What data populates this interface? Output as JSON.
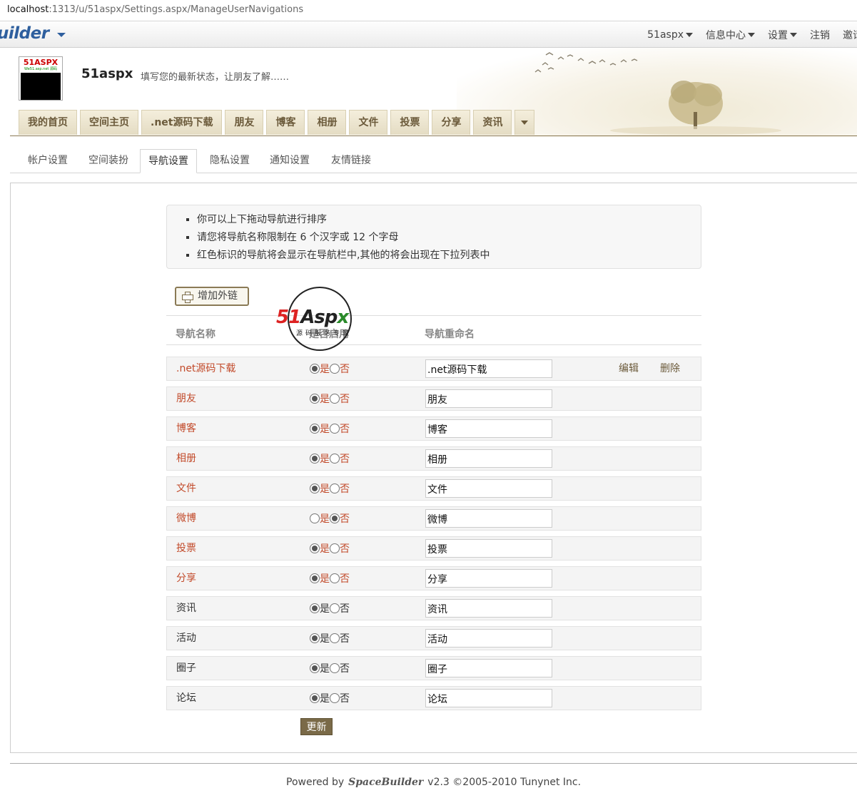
{
  "browser": {
    "url_host": "localhost",
    "url_path": ":1313/u/51aspx/Settings.aspx/ManageUserNavigations"
  },
  "topbar": {
    "brand": "uilder",
    "menu": [
      {
        "label": "51aspx",
        "dropdown": true
      },
      {
        "label": "信息中心",
        "dropdown": true
      },
      {
        "label": "设置",
        "dropdown": true
      },
      {
        "label": "注销",
        "dropdown": false
      },
      {
        "label": "邀请",
        "dropdown": false
      }
    ]
  },
  "header": {
    "avatar_logo": "51ASPX",
    "avatar_logo_sub": "We51.asp.net 源码",
    "username": "51aspx",
    "status_placeholder": "填写您的最新状态，让朋友了解……",
    "nav_tabs": [
      "我的首页",
      "空间主页",
      ".net源码下载",
      "朋友",
      "博客",
      "相册",
      "文件",
      "投票",
      "分享",
      "资讯"
    ]
  },
  "sub_tabs": [
    "帐户设置",
    "空间装扮",
    "导航设置",
    "隐私设置",
    "通知设置",
    "友情链接"
  ],
  "active_sub_tab": "导航设置",
  "tips": [
    "你可以上下拖动导航进行排序",
    "请您将导航名称限制在 6 个汉字或 12 个字母",
    "红色标识的导航将会显示在导航栏中,其他的将会出现在下拉列表中"
  ],
  "add_button": "增加外链",
  "columns": {
    "name": "导航名称",
    "enabled": "是否启用",
    "rename": "导航重命名"
  },
  "watermark": {
    "red": "51",
    "black": "Asp",
    "green": "x",
    "sub": "源码服务专家"
  },
  "radio_labels": {
    "yes": "是",
    "no": "否"
  },
  "row_actions": {
    "edit": "编辑",
    "delete": "删除"
  },
  "rows": [
    {
      "name": ".net源码下载",
      "enabled": true,
      "rename": ".net源码下载",
      "highlight": true,
      "actions": true
    },
    {
      "name": "朋友",
      "enabled": true,
      "rename": "朋友",
      "highlight": true
    },
    {
      "name": "博客",
      "enabled": true,
      "rename": "博客",
      "highlight": true
    },
    {
      "name": "相册",
      "enabled": true,
      "rename": "相册",
      "highlight": true
    },
    {
      "name": "文件",
      "enabled": true,
      "rename": "文件",
      "highlight": true
    },
    {
      "name": "微博",
      "enabled": false,
      "rename": "微博",
      "highlight": true
    },
    {
      "name": "投票",
      "enabled": true,
      "rename": "投票",
      "highlight": true
    },
    {
      "name": "分享",
      "enabled": true,
      "rename": "分享",
      "highlight": true
    },
    {
      "name": "资讯",
      "enabled": true,
      "rename": "资讯",
      "highlight": false
    },
    {
      "name": "活动",
      "enabled": true,
      "rename": "活动",
      "highlight": false
    },
    {
      "name": "圈子",
      "enabled": true,
      "rename": "圈子",
      "highlight": false
    },
    {
      "name": "论坛",
      "enabled": true,
      "rename": "论坛",
      "highlight": false
    }
  ],
  "update_button": "更新",
  "footer": {
    "powered": "Powered by",
    "product": "SpaceBuilder",
    "version": "v2.3 ©2005-2010 Tunynet Inc."
  }
}
